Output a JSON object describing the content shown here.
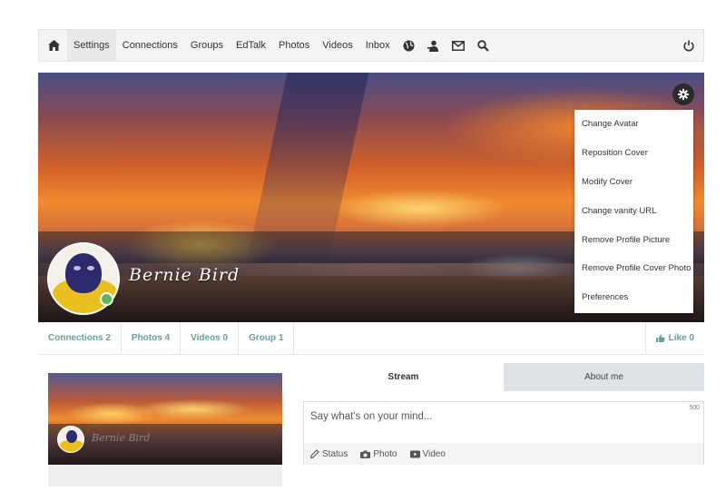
{
  "navbar": {
    "items": [
      {
        "label": "Settings",
        "active": true
      },
      {
        "label": "Connections"
      },
      {
        "label": "Groups"
      },
      {
        "label": "EdTalk"
      },
      {
        "label": "Photos"
      },
      {
        "label": "Videos"
      },
      {
        "label": "Inbox"
      }
    ],
    "icons": [
      "home-icon",
      "globe-icon",
      "user-icon",
      "mail-icon",
      "search-icon",
      "power-icon"
    ]
  },
  "profile": {
    "name": "Bernie Bird",
    "status": "online"
  },
  "cover_menu": {
    "items": [
      "Change Avatar",
      "Reposition Cover",
      "Modify Cover",
      "Change vanity URL",
      "Remove Profile Picture",
      "Remove Profile Cover Photo",
      "Preferences"
    ]
  },
  "profile_tabs": {
    "items": [
      "Connections 2",
      "Photos 4",
      "Videos 0",
      "Group 1"
    ],
    "like": "Like 0"
  },
  "mini_card": {
    "name": "Bernie Bird"
  },
  "stream_tabs": {
    "items": [
      "Stream",
      "About me"
    ],
    "active": "Stream"
  },
  "composer": {
    "placeholder": "Say what's on your mind...",
    "char_limit": "500",
    "actions": [
      "Status",
      "Photo",
      "Video"
    ]
  },
  "colors": {
    "tab_text": "#6a9fa0",
    "online": "#5cb85c",
    "inactive_tab": "#dde3e6"
  }
}
